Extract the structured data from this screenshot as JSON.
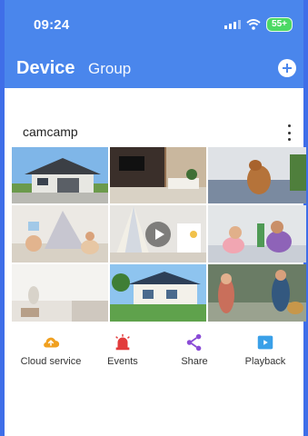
{
  "status_bar": {
    "time": "09:24",
    "battery": "55+"
  },
  "header": {
    "tab_device": "Device",
    "tab_group": "Group"
  },
  "card": {
    "title": "camcamp",
    "actions": [
      {
        "label": "Cloud service",
        "icon": "cloud-icon",
        "color": "#f0a020"
      },
      {
        "label": "Events",
        "icon": "alarm-light-icon",
        "color": "#e23b3b"
      },
      {
        "label": "Share",
        "icon": "share-icon",
        "color": "#8a4bd6"
      },
      {
        "label": "Playback",
        "icon": "playback-icon",
        "color": "#3aa0e8"
      }
    ]
  },
  "colors": {
    "header": "#4a86ec",
    "frame": "#3f6ee8"
  }
}
